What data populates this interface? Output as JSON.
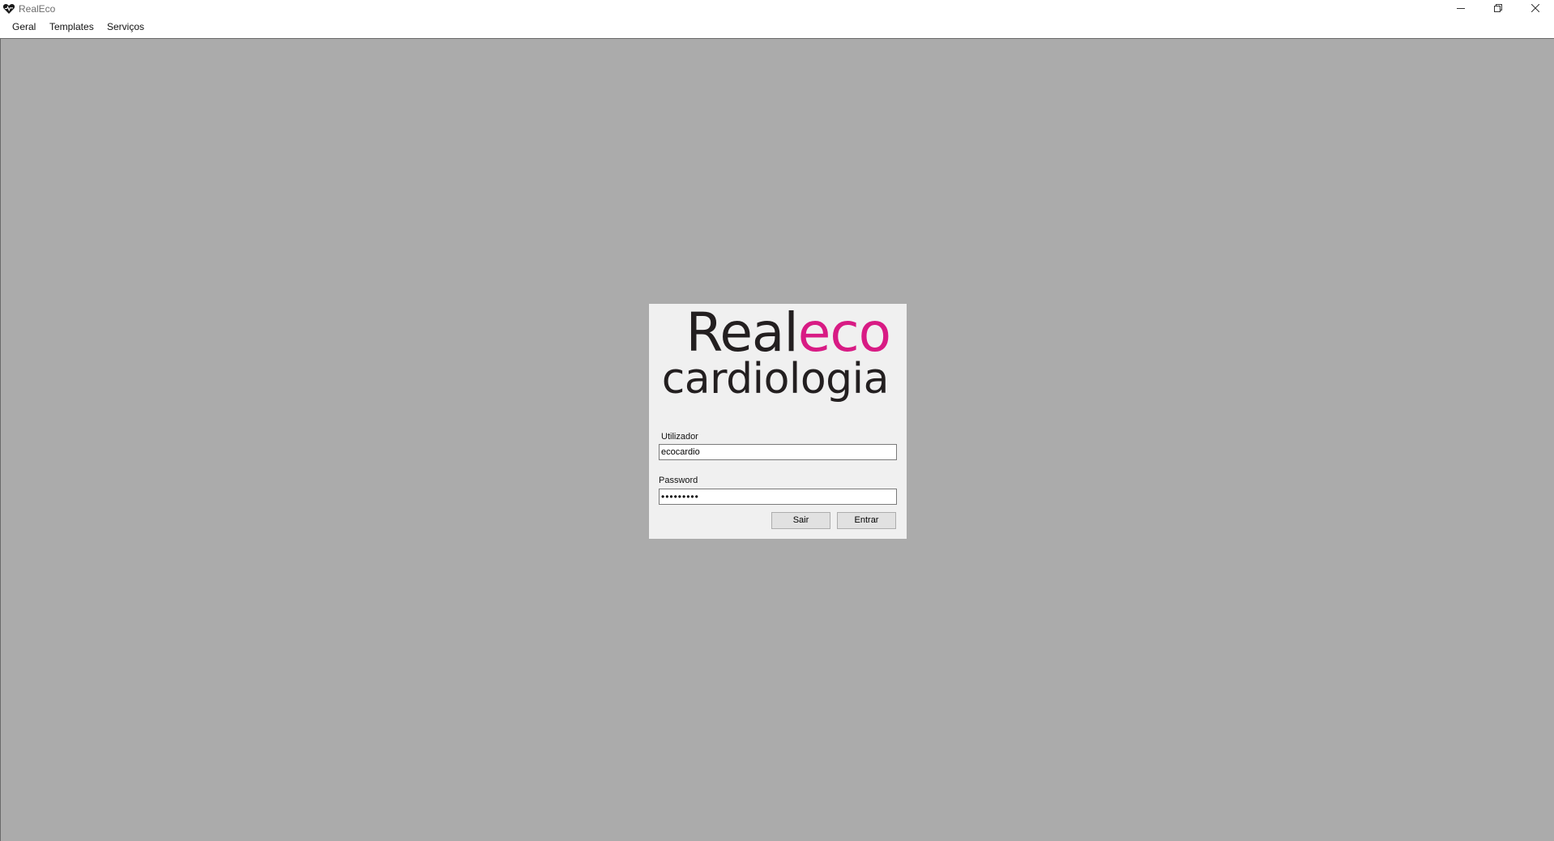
{
  "window": {
    "title": "RealEco",
    "icon": "heart-icon",
    "controls": {
      "minimize": "minimize-icon",
      "restore": "restore-icon",
      "close": "close-icon"
    }
  },
  "menu": {
    "items": [
      {
        "label": "Geral"
      },
      {
        "label": "Templates"
      },
      {
        "label": "Serviços"
      }
    ]
  },
  "login": {
    "logo": {
      "line1_part1": "Real",
      "line1_part2": "eco",
      "line2": "cardiologia",
      "accent_color": "#d81b84",
      "text_color": "#231f20"
    },
    "user_label": "Utilizador",
    "user_value": "ecocardio",
    "password_label": "Password",
    "password_value": "123456789",
    "sair_label": "Sair",
    "entrar_label": "Entrar"
  },
  "colors": {
    "workspace": "#ababab",
    "panel": "#f0f0f0"
  }
}
